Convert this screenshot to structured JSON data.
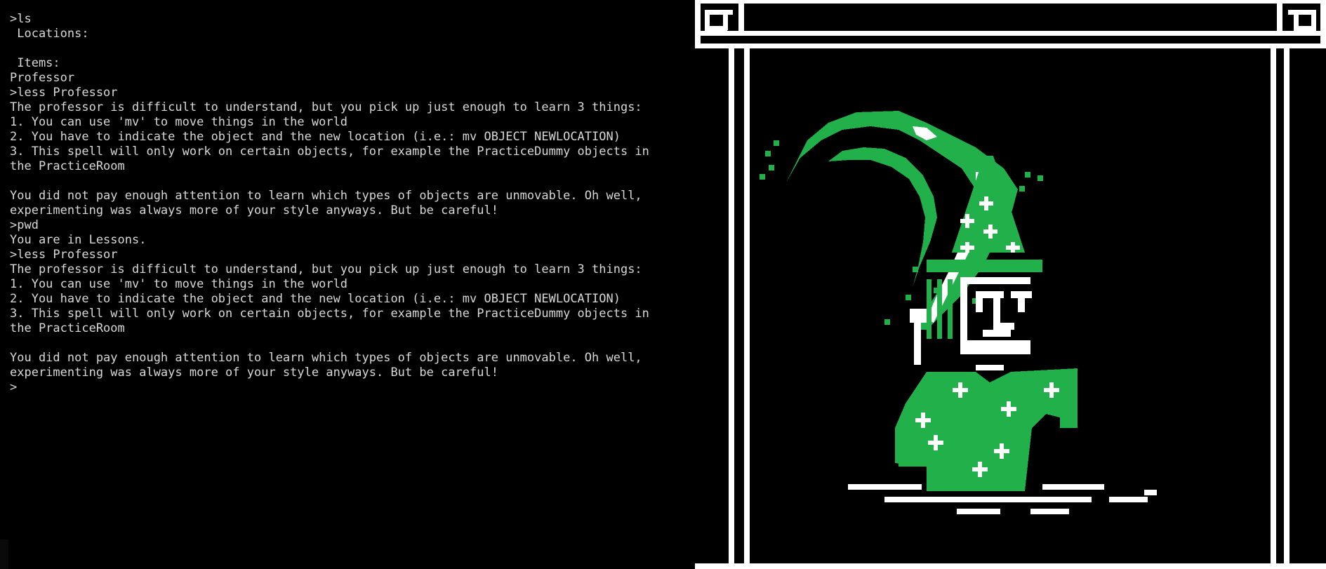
{
  "terminal": {
    "lines": [
      ">ls",
      " Locations:",
      "",
      " Items:",
      "Professor",
      ">less Professor",
      "The professor is difficult to understand, but you pick up just enough to learn 3 things:",
      "1. You can use 'mv' to move things in the world",
      "2. You have to indicate the object and the new location (i.e.: mv OBJECT NEWLOCATION)",
      "3. This spell will only work on certain objects, for example the PracticeDummy objects in",
      "the PracticeRoom",
      "",
      "You did not pay enough attention to learn which types of objects are unmovable. Oh well,",
      "experimenting was always more of your style anyways. But be careful!",
      ">pwd",
      "You are in Lessons.",
      ">less Professor",
      "The professor is difficult to understand, but you pick up just enough to learn 3 things:",
      "1. You can use 'mv' to move things in the world",
      "2. You have to indicate the object and the new location (i.e.: mv OBJECT NEWLOCATION)",
      "3. This spell will only work on certain objects, for example the PracticeDummy objects in",
      "the PracticeRoom",
      "",
      "You did not pay enough attention to learn which types of objects are unmovable. Oh well,",
      "experimenting was always more of your style anyways. But be careful!",
      ">"
    ]
  },
  "art": {
    "subject": "pixel-art wizard professor with star-patterned robe holding a quill",
    "colors": {
      "background": "#000000",
      "frame": "#ffffff",
      "robe": "#22b04b",
      "highlight": "#ffffff"
    }
  }
}
